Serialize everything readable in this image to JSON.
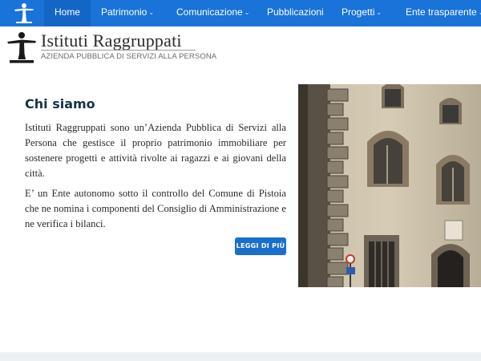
{
  "nav": {
    "items": [
      {
        "label": "Home",
        "caret": ""
      },
      {
        "label": "Patrimonio",
        "caret": "⌄"
      },
      {
        "label": "Comunicazione",
        "caret": "⌄"
      },
      {
        "label": "Pubblicazioni",
        "caret": ""
      },
      {
        "label": "Progetti",
        "caret": "⌄"
      },
      {
        "label": "Ente trasparente",
        "caret": "⌄"
      }
    ],
    "active": "Home",
    "logo_icon": "person-balance-icon"
  },
  "brand": {
    "name": "Istituti Raggruppati",
    "subtitle": "AZIENDA PUBBLICA DI SERVIZI ALLA PERSONA",
    "logo_icon": "person-balance-icon"
  },
  "about": {
    "title": "Chi siamo",
    "paragraphs": [
      "Istituti Raggruppati sono un’Azienda Pubblica di Servizi alla Persona che gestisce il proprio patrimonio immobiliare per sostenere progetti e attività rivolte ai ragazzi e ai giovani della città.",
      "E’ un Ente autonomo sotto il controllo del Comune di Pistoia che ne nomina i componenti del Consiglio di Amministrazione e ne verifica i bilanci."
    ],
    "button_label": "LEGGI DI PIÙ"
  },
  "colors": {
    "nav_bg": "#1a73d9",
    "nav_active_bg": "#1466c6",
    "title_color": "#17324d",
    "button_bg": "#1a6fcc"
  }
}
